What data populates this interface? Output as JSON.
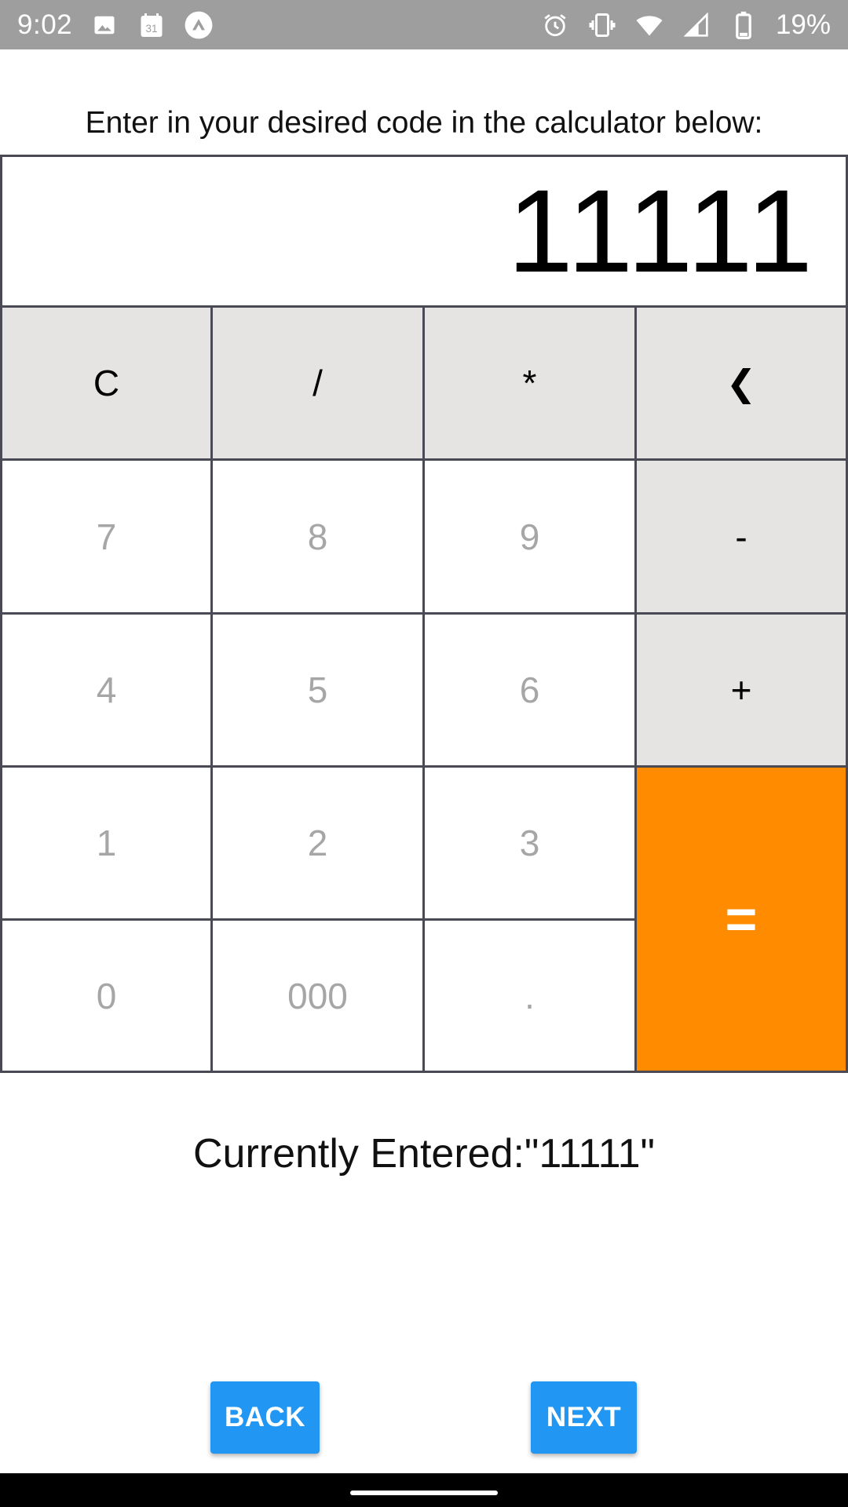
{
  "status_bar": {
    "time": "9:02",
    "calendar_day": "31",
    "battery": "19%",
    "left_icons": [
      "image-icon",
      "calendar-icon",
      "app-notification-icon"
    ],
    "right_icons": [
      "alarm-icon",
      "vibrate-icon",
      "wifi-icon",
      "cell-signal-icon",
      "battery-icon"
    ]
  },
  "prompt": "Enter in your desired code in the calculator below:",
  "display_value": "11111",
  "keys": {
    "clear": "C",
    "divide": "/",
    "multiply": "*",
    "backspace": "❮",
    "seven": "7",
    "eight": "8",
    "nine": "9",
    "minus": "-",
    "four": "4",
    "five": "5",
    "six": "6",
    "plus": "+",
    "one": "1",
    "two": "2",
    "three": "3",
    "equals": "=",
    "zero": "0",
    "triple_zero": "000",
    "decimal": "."
  },
  "currently_entered": "Currently Entered:\"11111\"",
  "buttons": {
    "back": "BACK",
    "next": "NEXT"
  },
  "colors": {
    "status_bar": "#9e9e9e",
    "operator_key": "#e5e4e3",
    "equals_key": "#ff8c00",
    "button": "#2196f3"
  }
}
